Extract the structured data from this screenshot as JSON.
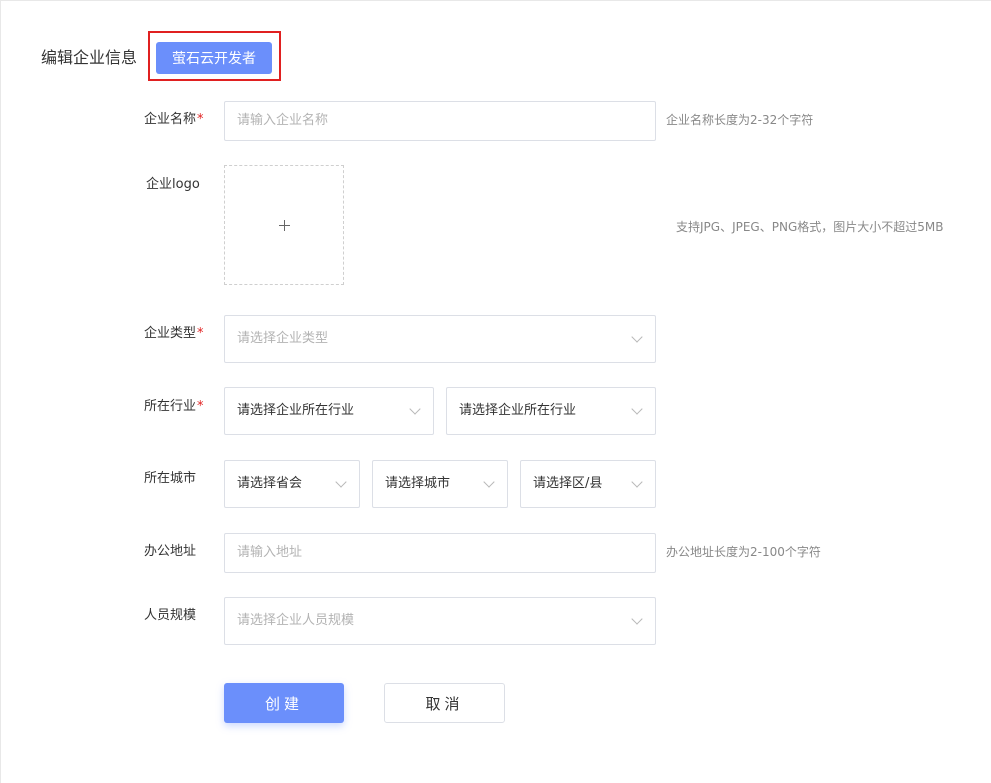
{
  "header": {
    "title": "编辑企业信息",
    "developer_button": "萤石云开发者"
  },
  "form": {
    "company_name": {
      "label": "企业名称",
      "required": "*",
      "placeholder": "请输入企业名称",
      "hint": "企业名称长度为2-32个字符"
    },
    "company_logo": {
      "label": "企业logo",
      "upload_icon": "plus-icon",
      "hint": "支持JPG、JPEG、PNG格式，图片大小不超过5MB"
    },
    "company_type": {
      "label": "企业类型",
      "required": "*",
      "placeholder": "请选择企业类型"
    },
    "industry": {
      "label": "所在行业",
      "required": "*",
      "select1": "请选择企业所在行业",
      "select2": "请选择企业所在行业"
    },
    "city": {
      "label": "所在城市",
      "province": "请选择省会",
      "city": "请选择城市",
      "district": "请选择区/县"
    },
    "address": {
      "label": "办公地址",
      "placeholder": "请输入地址",
      "hint": "办公地址长度为2-100个字符"
    },
    "staff_size": {
      "label": "人员规模",
      "placeholder": "请选择企业人员规模"
    }
  },
  "actions": {
    "create": "创建",
    "cancel": "取消"
  },
  "colors": {
    "primary": "#6b8ffb",
    "required": "#e02020",
    "highlight_border": "#e02020"
  }
}
